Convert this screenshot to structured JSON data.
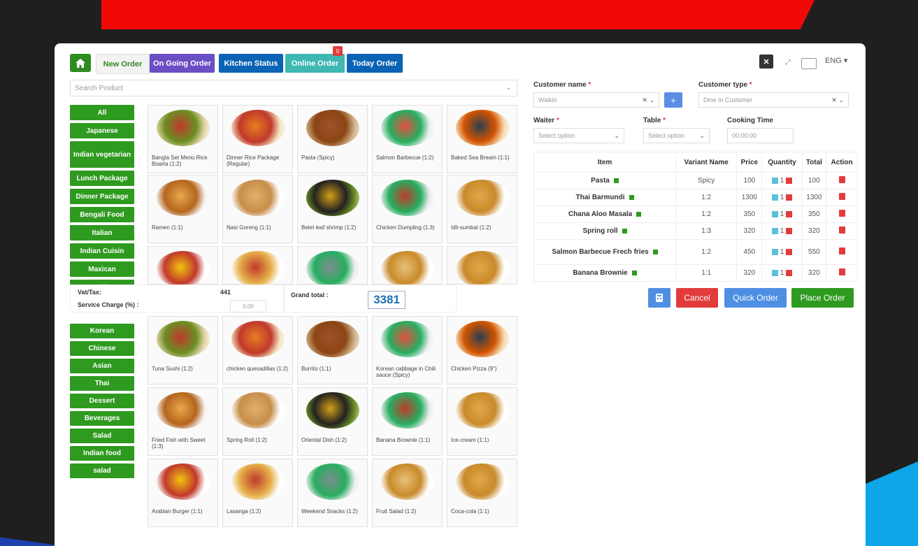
{
  "tabs": [
    {
      "label": "New Order"
    },
    {
      "label": "On Going Order"
    },
    {
      "label": "Kitchen Status"
    },
    {
      "label": "Online Order",
      "badge": "0"
    },
    {
      "label": "Today Order"
    }
  ],
  "top_right": {
    "language": "ENG ▾"
  },
  "search": {
    "placeholder": "Search Product"
  },
  "categories": [
    "All",
    "Japanese",
    "Indian vegetarian",
    "Lunch Package",
    "Dinner Package",
    "Bengali Food",
    "Italian",
    "Indian Cuisin",
    "Maxican",
    "Arabian",
    "Korean",
    "Chinese",
    "Asian",
    "Thai",
    "Dessert",
    "Beverages",
    "Salad",
    "Indian food",
    "salad"
  ],
  "products": [
    "Bangla Set Menu Rice Boarta (1:2)",
    "Dinner Rice Package (Regular)",
    "Pasta (Spicy)",
    "Salmon Barbecue (1:2)",
    "Baked Sea Bream (1:1)",
    "Ramen (1:1)",
    "Nasi Goreng (1:1)",
    "Betel leaf shrimp (1:2)",
    "Chicken Dumpling (1:3)",
    "Idli-sumbal (1:2)",
    "",
    "",
    "",
    "",
    "",
    "Tuna Sushi (1:2)",
    "chicken quesadillas (1:2)",
    "Burrito (1:1)",
    "Korean cabbage in Chili sauce (Spicy)",
    "Chicken Pizza (9\")",
    "Fried Fish with Sweet (1:3)",
    "Spring Roll (1:2)",
    "Oriental Dish (1:2)",
    "Banana Brownie (1:1)",
    "Ice-cream (1:1)",
    "Arabian Burger (1:1)",
    "Lasanga (1:2)",
    "Weekend Snacks (1:2)",
    "Fruit Salad (1:2)",
    "Coca-cola (1:1)"
  ],
  "form": {
    "customer_name_label": "Customer name",
    "customer_name_value": "Walkin",
    "customer_type_label": "Customer type",
    "customer_type_value": "Dine In Customer",
    "waiter_label": "Waiter",
    "waiter_placeholder": "Select option",
    "table_label": "Table",
    "table_placeholder": "Select option",
    "cooking_label": "Cooking Time",
    "cooking_value": "00:00:00",
    "required_mark": "*"
  },
  "cart": {
    "headers": [
      "Item",
      "Variant Name",
      "Price",
      "Quantity",
      "Total",
      "Action"
    ],
    "rows": [
      {
        "item": "Pasta",
        "variant": "Spicy",
        "price": "100",
        "qty": "1",
        "total": "100"
      },
      {
        "item": "Thai Barmundi",
        "variant": "1:2",
        "price": "1300",
        "qty": "1",
        "total": "1300"
      },
      {
        "item": "Chana Aloo Masala",
        "variant": "1:2",
        "price": "350",
        "qty": "1",
        "total": "350"
      },
      {
        "item": "Spring roll",
        "variant": "1:3",
        "price": "320",
        "qty": "1",
        "total": "320"
      },
      {
        "item": "Salmon Barbecue Frech fries",
        "variant": "1:2",
        "price": "450",
        "qty": "1",
        "total": "550"
      },
      {
        "item": "Banana Brownie",
        "variant": "1:1",
        "price": "320",
        "qty": "1",
        "total": "320"
      }
    ]
  },
  "totals": {
    "vat_label": "Vat/Tax:",
    "vat_value": "441",
    "service_label": "Service Charge (%) :",
    "service_value": "0.00",
    "grand_label": "Grand total :",
    "grand_value": "3381"
  },
  "actions": {
    "cancel": "Cancel",
    "quick": "Quick Order",
    "place": "Place Order"
  },
  "colors": {
    "green": "#2e9a1f",
    "red": "#e23b3b",
    "blue": "#4f8fe3",
    "navy": "#0a63b5",
    "purple": "#6a4fc4",
    "teal": "#3fb7b3"
  }
}
